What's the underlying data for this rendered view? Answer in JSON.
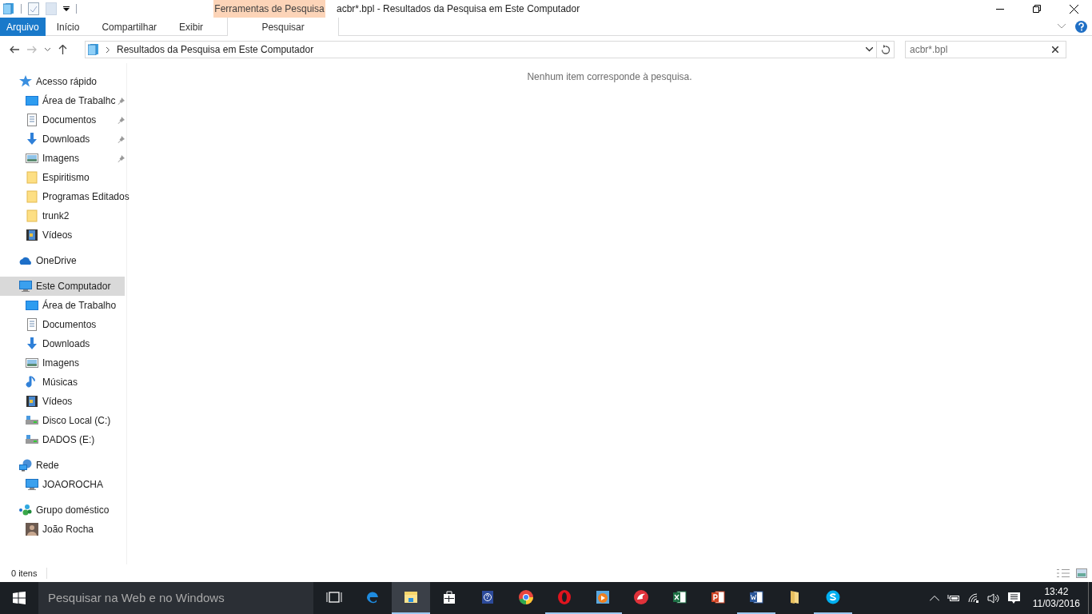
{
  "window": {
    "title": "acbr*.bpl - Resultados da Pesquisa em Este Computador",
    "context_tab_group": "Ferramentas de Pesquisa"
  },
  "ribbon_tabs": [
    {
      "label": "Arquivo",
      "kind": "file",
      "selected": false
    },
    {
      "label": "Início",
      "kind": "tab",
      "selected": false
    },
    {
      "label": "Compartilhar",
      "kind": "tab",
      "selected": false
    },
    {
      "label": "Exibir",
      "kind": "tab",
      "selected": false
    },
    {
      "label": "Pesquisar",
      "kind": "context",
      "selected": true
    }
  ],
  "address_bar": {
    "path": "Resultados da Pesquisa em Este Computador"
  },
  "search": {
    "value": "acbr*.bpl"
  },
  "sidebar": [
    {
      "label": "Acesso rápido",
      "kind": "star",
      "selected": false,
      "children": [
        {
          "label": "Área de Trabalhc",
          "kind": "desktop",
          "pinned": true,
          "selected": false
        },
        {
          "label": "Documentos",
          "kind": "document",
          "pinned": true,
          "selected": false
        },
        {
          "label": "Downloads",
          "kind": "download",
          "pinned": true,
          "selected": false
        },
        {
          "label": "Imagens",
          "kind": "picture",
          "pinned": true,
          "selected": false
        },
        {
          "label": "Espiritismo",
          "kind": "folder",
          "pinned": false,
          "selected": false
        },
        {
          "label": "Programas Editados",
          "kind": "folder",
          "pinned": false,
          "selected": false
        },
        {
          "label": "trunk2",
          "kind": "folder",
          "pinned": false,
          "selected": false
        },
        {
          "label": "Vídeos",
          "kind": "video",
          "pinned": false,
          "selected": false
        }
      ]
    },
    {
      "label": "OneDrive",
      "kind": "cloud",
      "selected": false
    },
    {
      "label": "Este Computador",
      "kind": "computer",
      "selected": true,
      "children": [
        {
          "label": "Área de Trabalho",
          "kind": "desktop",
          "pinned": false,
          "selected": false
        },
        {
          "label": "Documentos",
          "kind": "document",
          "pinned": false,
          "selected": false
        },
        {
          "label": "Downloads",
          "kind": "download",
          "pinned": false,
          "selected": false
        },
        {
          "label": "Imagens",
          "kind": "picture",
          "pinned": false,
          "selected": false
        },
        {
          "label": "Músicas",
          "kind": "music",
          "pinned": false,
          "selected": false
        },
        {
          "label": "Vídeos",
          "kind": "video",
          "pinned": false,
          "selected": false
        },
        {
          "label": "Disco Local (C:)",
          "kind": "drive",
          "pinned": false,
          "selected": false
        },
        {
          "label": "DADOS (E:)",
          "kind": "drive",
          "pinned": false,
          "selected": false
        }
      ]
    },
    {
      "label": "Rede",
      "kind": "network",
      "selected": false,
      "children": [
        {
          "label": "JOAOROCHA",
          "kind": "computer",
          "pinned": false,
          "selected": false
        }
      ]
    },
    {
      "label": "Grupo doméstico",
      "kind": "homegroup",
      "selected": false,
      "children": [
        {
          "label": "João Rocha",
          "kind": "avatar",
          "pinned": false,
          "selected": false
        }
      ]
    }
  ],
  "content": {
    "empty_message": "Nenhum item corresponde à pesquisa."
  },
  "status_bar": {
    "item_count": "0 itens"
  },
  "taskbar": {
    "search_placeholder": "Pesquisar na Web e no Windows",
    "apps": [
      {
        "kind": "taskview",
        "open": false,
        "active": false
      },
      {
        "kind": "edge",
        "open": false,
        "active": false
      },
      {
        "kind": "explorer",
        "open": true,
        "active": true
      },
      {
        "kind": "store",
        "open": false,
        "active": false
      },
      {
        "kind": "help",
        "open": false,
        "active": false
      },
      {
        "kind": "chrome",
        "open": false,
        "active": false
      },
      {
        "kind": "opera",
        "open": true,
        "active": false
      },
      {
        "kind": "media",
        "open": true,
        "active": false
      },
      {
        "kind": "redapp",
        "open": false,
        "active": false
      },
      {
        "kind": "excel",
        "open": false,
        "active": false
      },
      {
        "kind": "powerpoint",
        "open": false,
        "active": false
      },
      {
        "kind": "word",
        "open": true,
        "active": false
      },
      {
        "kind": "folder",
        "open": false,
        "active": false
      },
      {
        "kind": "skype",
        "open": true,
        "active": false
      }
    ],
    "time": "13:42",
    "date": "11/03/2016"
  }
}
